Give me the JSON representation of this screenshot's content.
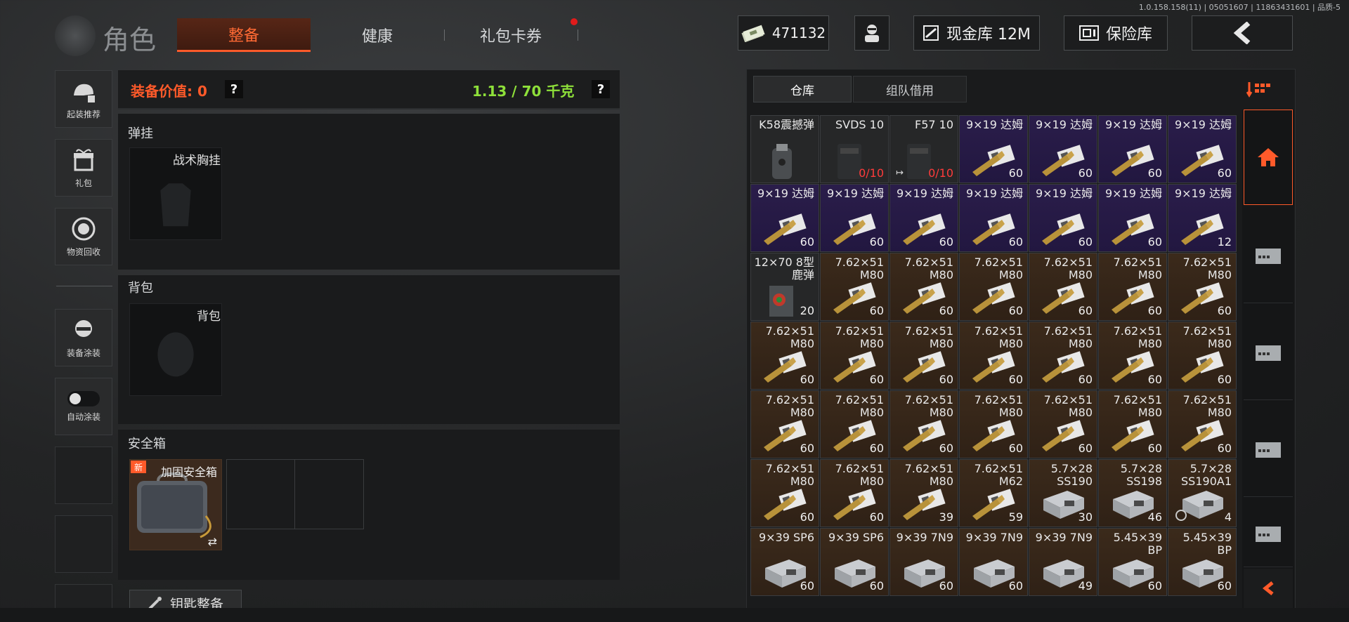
{
  "version": "1.0.158.158(11) | 05051607 | 11863431601 | 品质-5",
  "header": {
    "title": "角色",
    "tabs": [
      "整备",
      "健康",
      "礼包卡券"
    ],
    "money": "471132",
    "cash_vault": "现金库 12M",
    "safe_vault": "保险库"
  },
  "rail": [
    "起装推荐",
    "礼包",
    "物资回收",
    "装备涂装",
    "自动涂装"
  ],
  "equipment": {
    "value_label": "装备价值: 0",
    "q": "?",
    "weight": "1.13 / 70 千克",
    "rig_title": "弹挂",
    "rig_slot": "战术胸挂",
    "backpack_title": "背包",
    "backpack_slot": "背包",
    "safebox_title": "安全箱",
    "new_badge": "新",
    "safebox_name": "加固安全箱",
    "swap": "⇄",
    "key_label": "钥匙整备"
  },
  "warehouse": {
    "tabs": [
      "仓库",
      "组队借用"
    ],
    "items": [
      {
        "n": "K58震撼弹",
        "c": "",
        "t": "dark",
        "k": "grenade"
      },
      {
        "n": "SVDS 10",
        "c": "0/10",
        "t": "dark",
        "k": "mag",
        "red": true
      },
      {
        "n": "F57 10",
        "c": "0/10",
        "t": "dark",
        "k": "mag",
        "red": true,
        "ex": "↦"
      },
      {
        "n": "9×19 达姆",
        "c": "60",
        "t": "purple",
        "k": "ammo"
      },
      {
        "n": "9×19 达姆",
        "c": "60",
        "t": "purple",
        "k": "ammo"
      },
      {
        "n": "9×19 达姆",
        "c": "60",
        "t": "purple",
        "k": "ammo"
      },
      {
        "n": "9×19 达姆",
        "c": "60",
        "t": "purple",
        "k": "ammo"
      },
      {
        "n": "9×19 达姆",
        "c": "60",
        "t": "purple",
        "k": "ammo"
      },
      {
        "n": "9×19 达姆",
        "c": "60",
        "t": "purple",
        "k": "ammo"
      },
      {
        "n": "9×19 达姆",
        "c": "60",
        "t": "purple",
        "k": "ammo"
      },
      {
        "n": "9×19 达姆",
        "c": "60",
        "t": "purple",
        "k": "ammo"
      },
      {
        "n": "9×19 达姆",
        "c": "60",
        "t": "purple",
        "k": "ammo"
      },
      {
        "n": "9×19 达姆",
        "c": "60",
        "t": "purple",
        "k": "ammo"
      },
      {
        "n": "9×19 达姆",
        "c": "12",
        "t": "purple",
        "k": "ammo"
      },
      {
        "n": "12×70 8型鹿弹",
        "c": "20",
        "t": "dark",
        "k": "shell"
      },
      {
        "n": "7.62×51 M80",
        "c": "60",
        "t": "brown",
        "k": "ammo"
      },
      {
        "n": "7.62×51 M80",
        "c": "60",
        "t": "brown",
        "k": "ammo"
      },
      {
        "n": "7.62×51 M80",
        "c": "60",
        "t": "brown",
        "k": "ammo"
      },
      {
        "n": "7.62×51 M80",
        "c": "60",
        "t": "brown",
        "k": "ammo"
      },
      {
        "n": "7.62×51 M80",
        "c": "60",
        "t": "brown",
        "k": "ammo"
      },
      {
        "n": "7.62×51 M80",
        "c": "60",
        "t": "brown",
        "k": "ammo"
      },
      {
        "n": "7.62×51 M80",
        "c": "60",
        "t": "brown",
        "k": "ammo"
      },
      {
        "n": "7.62×51 M80",
        "c": "60",
        "t": "brown",
        "k": "ammo"
      },
      {
        "n": "7.62×51 M80",
        "c": "60",
        "t": "brown",
        "k": "ammo"
      },
      {
        "n": "7.62×51 M80",
        "c": "60",
        "t": "brown",
        "k": "ammo"
      },
      {
        "n": "7.62×51 M80",
        "c": "60",
        "t": "brown",
        "k": "ammo"
      },
      {
        "n": "7.62×51 M80",
        "c": "60",
        "t": "brown",
        "k": "ammo"
      },
      {
        "n": "7.62×51 M80",
        "c": "60",
        "t": "brown",
        "k": "ammo"
      },
      {
        "n": "7.62×51 M80",
        "c": "60",
        "t": "brown",
        "k": "ammo"
      },
      {
        "n": "7.62×51 M80",
        "c": "60",
        "t": "brown",
        "k": "ammo"
      },
      {
        "n": "7.62×51 M80",
        "c": "60",
        "t": "brown",
        "k": "ammo"
      },
      {
        "n": "7.62×51 M80",
        "c": "60",
        "t": "brown",
        "k": "ammo"
      },
      {
        "n": "7.62×51 M80",
        "c": "60",
        "t": "brown",
        "k": "ammo"
      },
      {
        "n": "7.62×51 M80",
        "c": "60",
        "t": "brown",
        "k": "ammo"
      },
      {
        "n": "7.62×51 M80",
        "c": "60",
        "t": "brown",
        "k": "ammo"
      },
      {
        "n": "7.62×51 M80",
        "c": "60",
        "t": "brown",
        "k": "ammo"
      },
      {
        "n": "7.62×51 M80",
        "c": "60",
        "t": "brown",
        "k": "ammo"
      },
      {
        "n": "7.62×51 M80",
        "c": "39",
        "t": "brown",
        "k": "ammo"
      },
      {
        "n": "7.62×51 M62",
        "c": "59",
        "t": "brown",
        "k": "ammo"
      },
      {
        "n": "5.7×28 SS190",
        "c": "30",
        "t": "brown",
        "k": "box"
      },
      {
        "n": "5.7×28 SS198",
        "c": "46",
        "t": "brown",
        "k": "box"
      },
      {
        "n": "5.7×28 SS190A1",
        "c": "4",
        "t": "brown",
        "k": "box",
        "mark": true
      },
      {
        "n": "9×39 SP6",
        "c": "60",
        "t": "brown",
        "k": "box"
      },
      {
        "n": "9×39 SP6",
        "c": "60",
        "t": "brown",
        "k": "box"
      },
      {
        "n": "9×39 7N9",
        "c": "60",
        "t": "brown",
        "k": "box"
      },
      {
        "n": "9×39 7N9",
        "c": "60",
        "t": "brown",
        "k": "box"
      },
      {
        "n": "9×39 7N9",
        "c": "49",
        "t": "brown",
        "k": "box"
      },
      {
        "n": "5.45×39 BP",
        "c": "60",
        "t": "brown",
        "k": "box"
      },
      {
        "n": "5.45×39 BP",
        "c": "60",
        "t": "brown",
        "k": "box"
      }
    ]
  },
  "colors": {
    "accent": "#ff5a2a",
    "weight": "#8ee03a",
    "purple_tier": "#2a1d4a",
    "brown_tier": "#3b2a1b"
  },
  "icons": [
    "money-icon",
    "character-icon",
    "cash-vault-icon",
    "safe-icon",
    "back-arrow-icon",
    "sort-icon",
    "home-icon",
    "box-icon",
    "collapse-arrow-icon"
  ]
}
